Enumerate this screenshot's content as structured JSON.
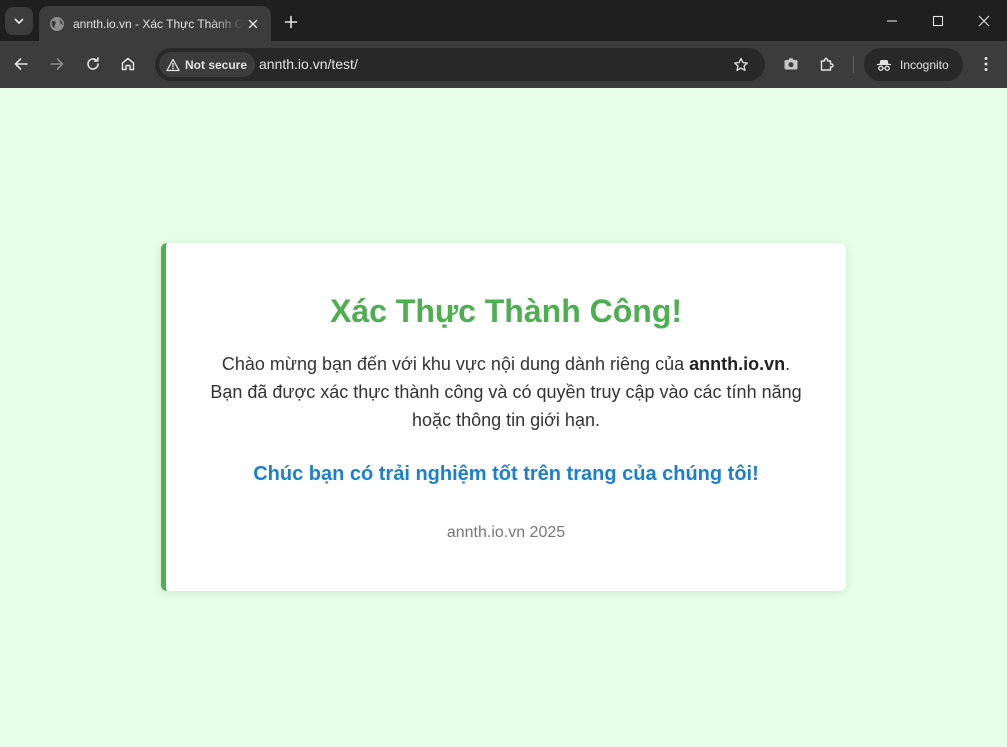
{
  "browser": {
    "tab": {
      "title": "annth.io.vn - Xác Thực Thành Công!"
    },
    "omnibox": {
      "security_label": "Not secure",
      "url": "annth.io.vn/test/"
    },
    "incognito_label": "Incognito"
  },
  "page": {
    "title": "Xác Thực Thành Công!",
    "message_before": "Chào mừng bạn đến với khu vực nội dung dành riêng của ",
    "message_site": "annth.io.vn",
    "message_after": ". Bạn đã được xác thực thành công và có quyền truy cập vào các tính năng hoặc thông tin giới hạn.",
    "highlight": "Chúc bạn có trải nghiệm tốt trên trang của chúng tôi!",
    "footer": "annth.io.vn 2025"
  },
  "colors": {
    "page_background": "#e6ffe6",
    "accent_green": "#4caf50",
    "highlight_blue": "#1a7fd4",
    "browser_frame": "#1f1f1f",
    "browser_toolbar": "#3c3c3c"
  },
  "icons": {
    "tab_search": "chevron-down-icon",
    "favicon": "globe-icon",
    "tab_close": "close-icon",
    "new_tab": "plus-icon",
    "minimize": "minimize-icon",
    "maximize": "maximize-icon",
    "window_close": "close-icon",
    "back": "back-arrow-icon",
    "forward": "forward-arrow-icon",
    "reload": "reload-icon",
    "home": "home-icon",
    "security": "warning-icon",
    "bookmark": "star-icon",
    "camera": "camera-icon",
    "extensions": "puzzle-icon",
    "incognito": "incognito-icon",
    "menu": "kebab-menu-icon"
  }
}
